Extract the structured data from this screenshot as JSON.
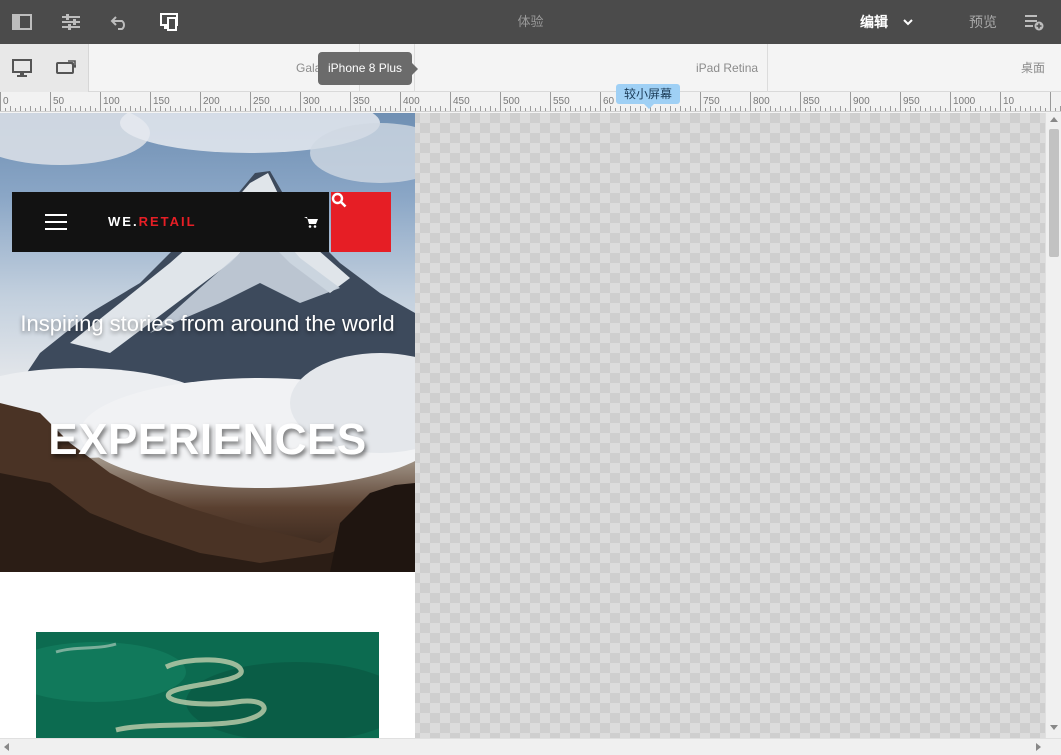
{
  "toolbar": {
    "title": "体验",
    "mode_edit": "编辑",
    "mode_preview": "预览",
    "icons": [
      "side-panel-icon",
      "properties-icon",
      "undo-icon",
      "emulator-icon",
      "chevron-down-icon",
      "page-info-icon"
    ],
    "bg_color": "#4b4b4b"
  },
  "emulator": {
    "devices": [
      {
        "label": "Gala"
      },
      {
        "label": "iPad Retina"
      },
      {
        "label": "桌面"
      }
    ],
    "tooltip": "iPhone 8 Plus",
    "buttons": [
      "desktop-icon",
      "rotate-device-icon"
    ]
  },
  "ruler": {
    "marks": [
      "0",
      "50",
      "100",
      "150",
      "200",
      "250",
      "300",
      "350",
      "400",
      "450",
      "500",
      "550",
      "60",
      "700",
      "750",
      "800",
      "850",
      "900",
      "950",
      "1000",
      "10"
    ],
    "tooltip": "较小屏幕"
  },
  "page": {
    "brand_main": "WE.",
    "brand_accent": "RETAIL",
    "hero_subtitle": "Inspiring stories from around the world",
    "hero_title": "EXPERIENCES",
    "accent_color": "#e61e25"
  }
}
